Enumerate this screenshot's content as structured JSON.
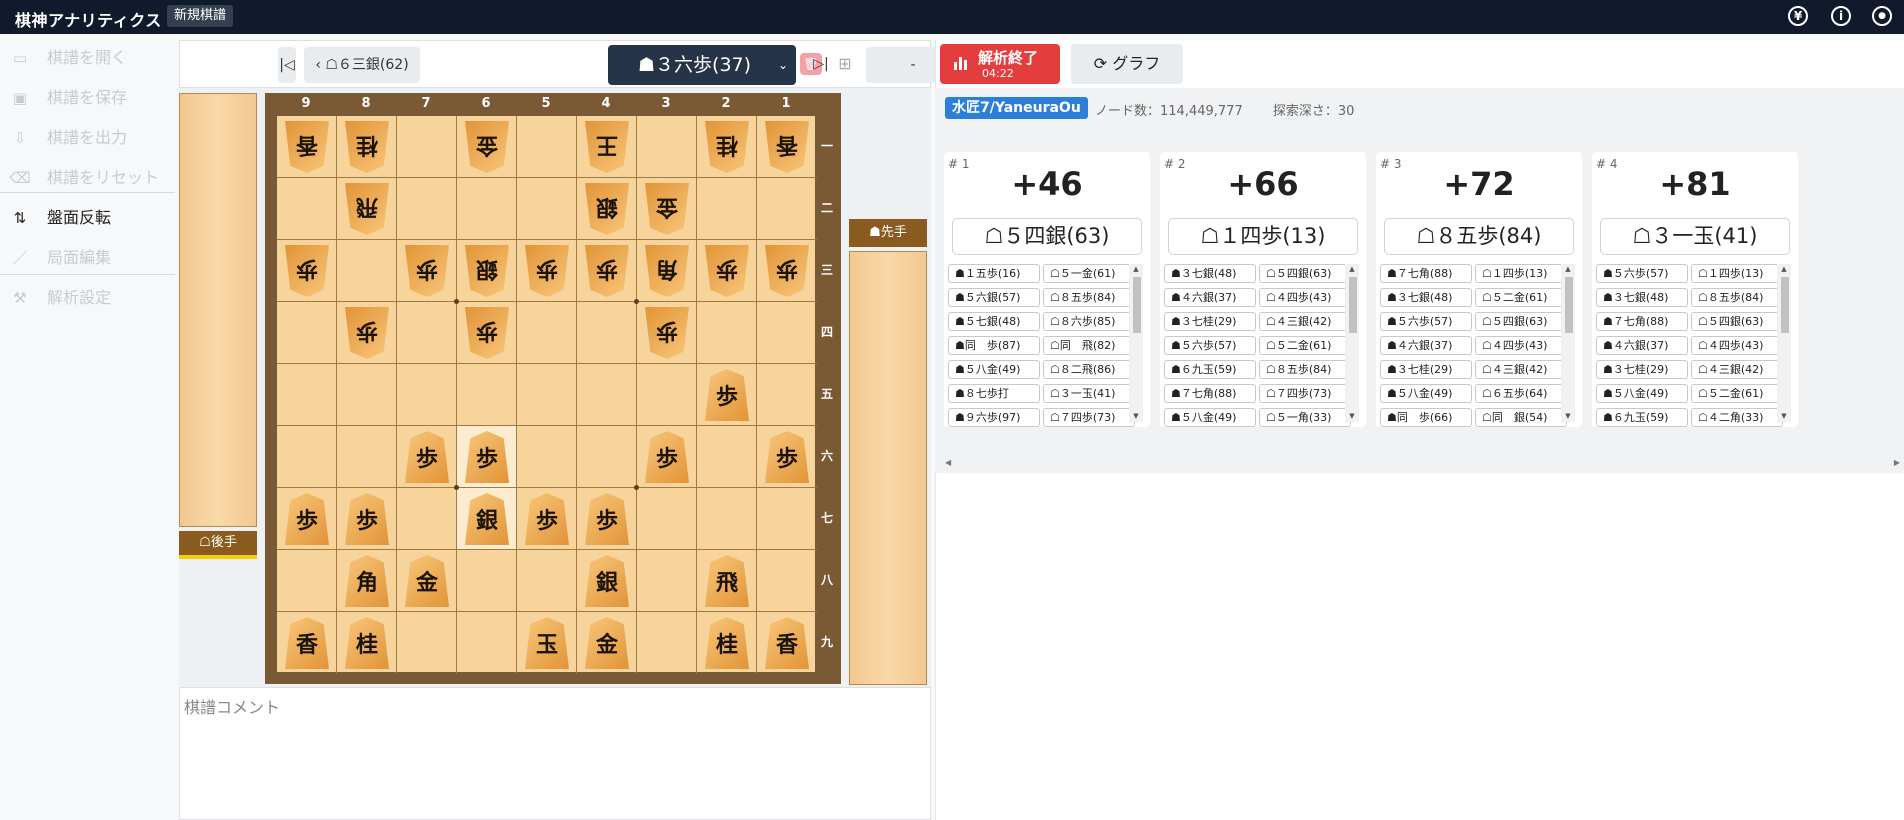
{
  "app": {
    "title": "棋神アナリティクス",
    "game_tag": "新規棋譜"
  },
  "header_icons": [
    {
      "name": "yen-icon",
      "glyph": "¥"
    },
    {
      "name": "info-icon",
      "glyph": "i"
    },
    {
      "name": "user-icon",
      "glyph": "●"
    }
  ],
  "sidebar": {
    "items": [
      {
        "label": "棋譜を開く",
        "icon": "folder-open-icon",
        "glyph": "▭",
        "enabled": false
      },
      {
        "label": "棋譜を保存",
        "icon": "save-icon",
        "glyph": "▣",
        "enabled": false
      },
      {
        "label": "棋譜を出力",
        "icon": "export-icon",
        "glyph": "⇩",
        "enabled": false
      },
      {
        "label": "棋譜をリセット",
        "icon": "trash-icon",
        "glyph": "⌫",
        "enabled": false
      },
      {
        "label": "盤面反転",
        "icon": "flip-icon",
        "glyph": "⇅",
        "enabled": true
      },
      {
        "label": "局面編集",
        "icon": "pencil-icon",
        "glyph": "／",
        "enabled": false
      },
      {
        "label": "解析設定",
        "icon": "wrench-icon",
        "glyph": "⚒",
        "enabled": false
      }
    ]
  },
  "nav": {
    "first_glyph": "|◁",
    "prev_glyph": "‹",
    "prev_move": "☖６三銀(62)",
    "current_move": "☗３六歩(37)",
    "next_move": "-",
    "next_glyph": "›",
    "last_glyph": "▷|",
    "delete_glyph": "🗑",
    "add_glyph": "⊞",
    "dropdown_glyph": "⌄"
  },
  "board": {
    "files": [
      "9",
      "8",
      "7",
      "6",
      "5",
      "4",
      "3",
      "2",
      "1"
    ],
    "ranks": [
      "一",
      "二",
      "三",
      "四",
      "五",
      "六",
      "七",
      "八",
      "九"
    ],
    "highlight": [
      [
        6,
        6
      ],
      [
        6,
        7
      ]
    ],
    "pieces": [
      {
        "k": "香",
        "f": 9,
        "r": 1,
        "o": "g"
      },
      {
        "k": "桂",
        "f": 8,
        "r": 1,
        "o": "g"
      },
      {
        "k": "金",
        "f": 6,
        "r": 1,
        "o": "g"
      },
      {
        "k": "王",
        "f": 4,
        "r": 1,
        "o": "g"
      },
      {
        "k": "桂",
        "f": 2,
        "r": 1,
        "o": "g"
      },
      {
        "k": "香",
        "f": 1,
        "r": 1,
        "o": "g"
      },
      {
        "k": "飛",
        "f": 8,
        "r": 2,
        "o": "g"
      },
      {
        "k": "銀",
        "f": 4,
        "r": 2,
        "o": "g"
      },
      {
        "k": "金",
        "f": 3,
        "r": 2,
        "o": "g"
      },
      {
        "k": "歩",
        "f": 9,
        "r": 3,
        "o": "g"
      },
      {
        "k": "歩",
        "f": 7,
        "r": 3,
        "o": "g"
      },
      {
        "k": "銀",
        "f": 6,
        "r": 3,
        "o": "g"
      },
      {
        "k": "歩",
        "f": 5,
        "r": 3,
        "o": "g"
      },
      {
        "k": "歩",
        "f": 4,
        "r": 3,
        "o": "g"
      },
      {
        "k": "角",
        "f": 3,
        "r": 3,
        "o": "g"
      },
      {
        "k": "歩",
        "f": 2,
        "r": 3,
        "o": "g"
      },
      {
        "k": "歩",
        "f": 1,
        "r": 3,
        "o": "g"
      },
      {
        "k": "歩",
        "f": 8,
        "r": 4,
        "o": "g"
      },
      {
        "k": "歩",
        "f": 6,
        "r": 4,
        "o": "g"
      },
      {
        "k": "歩",
        "f": 3,
        "r": 4,
        "o": "g"
      },
      {
        "k": "歩",
        "f": 2,
        "r": 5,
        "o": "s"
      },
      {
        "k": "歩",
        "f": 7,
        "r": 6,
        "o": "s"
      },
      {
        "k": "歩",
        "f": 6,
        "r": 6,
        "o": "s"
      },
      {
        "k": "歩",
        "f": 3,
        "r": 6,
        "o": "s"
      },
      {
        "k": "歩",
        "f": 1,
        "r": 6,
        "o": "s"
      },
      {
        "k": "歩",
        "f": 9,
        "r": 7,
        "o": "s"
      },
      {
        "k": "歩",
        "f": 8,
        "r": 7,
        "o": "s"
      },
      {
        "k": "銀",
        "f": 6,
        "r": 7,
        "o": "s"
      },
      {
        "k": "歩",
        "f": 5,
        "r": 7,
        "o": "s"
      },
      {
        "k": "歩",
        "f": 4,
        "r": 7,
        "o": "s"
      },
      {
        "k": "角",
        "f": 8,
        "r": 8,
        "o": "s"
      },
      {
        "k": "金",
        "f": 7,
        "r": 8,
        "o": "s"
      },
      {
        "k": "銀",
        "f": 4,
        "r": 8,
        "o": "s"
      },
      {
        "k": "飛",
        "f": 2,
        "r": 8,
        "o": "s"
      },
      {
        "k": "香",
        "f": 9,
        "r": 9,
        "o": "s"
      },
      {
        "k": "桂",
        "f": 8,
        "r": 9,
        "o": "s"
      },
      {
        "k": "玉",
        "f": 5,
        "r": 9,
        "o": "s"
      },
      {
        "k": "金",
        "f": 4,
        "r": 9,
        "o": "s"
      },
      {
        "k": "桂",
        "f": 2,
        "r": 9,
        "o": "s"
      },
      {
        "k": "香",
        "f": 1,
        "r": 9,
        "o": "s"
      }
    ]
  },
  "players": {
    "gote": "☖後手",
    "sente": "☗先手"
  },
  "comment": {
    "placeholder": "棋譜コメント"
  },
  "analysis": {
    "stop_label": "解析終了",
    "stop_time": "04:22",
    "graph_label": "⟳ グラフ",
    "engine": "水匠7/YaneuraOu",
    "nodes_label": "ノード数：",
    "nodes": "114,449,777",
    "depth_label": "探索深さ：",
    "depth": "30",
    "variations": [
      {
        "rank": "# 1",
        "score": "+46",
        "move": "☖５四銀(63)",
        "moves": [
          "☗１五歩(16)",
          "☖５一金(61)",
          "☗５六銀(57)",
          "☖８五歩(84)",
          "☗５七銀(48)",
          "☖８六歩(85)",
          "☗同　歩(87)",
          "☖同　飛(82)",
          "☗５八金(49)",
          "☖８二飛(86)",
          "☗８七歩打",
          "☖３一玉(41)",
          "☗９六歩(97)",
          "☖７四歩(73)"
        ]
      },
      {
        "rank": "# 2",
        "score": "+66",
        "move": "☖１四歩(13)",
        "moves": [
          "☗３七銀(48)",
          "☖５四銀(63)",
          "☗４六銀(37)",
          "☖４四歩(43)",
          "☗３七桂(29)",
          "☖４三銀(42)",
          "☗５六歩(57)",
          "☖５二金(61)",
          "☗６九玉(59)",
          "☖８五歩(84)",
          "☗７七角(88)",
          "☖７四歩(73)",
          "☗５八金(49)",
          "☖５一角(33)"
        ]
      },
      {
        "rank": "# 3",
        "score": "+72",
        "move": "☖８五歩(84)",
        "moves": [
          "☗７七角(88)",
          "☖１四歩(13)",
          "☗３七銀(48)",
          "☖５二金(61)",
          "☗５六歩(57)",
          "☖５四銀(63)",
          "☗４六銀(37)",
          "☖４四歩(43)",
          "☗３七桂(29)",
          "☖４三銀(42)",
          "☗５八金(49)",
          "☖６五歩(64)",
          "☗同　歩(66)",
          "☖同　銀(54)"
        ]
      },
      {
        "rank": "# 4",
        "score": "+81",
        "move": "☖３一玉(41)",
        "moves": [
          "☗５六歩(57)",
          "☖１四歩(13)",
          "☗３七銀(48)",
          "☖８五歩(84)",
          "☗７七角(88)",
          "☖５四銀(63)",
          "☗４六銀(37)",
          "☖４四歩(43)",
          "☗３七桂(29)",
          "☖４三銀(42)",
          "☗５八金(49)",
          "☖５二金(61)",
          "☗６九玉(59)",
          "☖４二角(33)"
        ]
      }
    ]
  },
  "colors": {
    "topbar": "#101a2c",
    "stop": "#e43d3d",
    "engine_badge": "#2b7fd9",
    "board": "#f6d49b",
    "stand": "#f2c88f",
    "nav_current": "#263449"
  }
}
